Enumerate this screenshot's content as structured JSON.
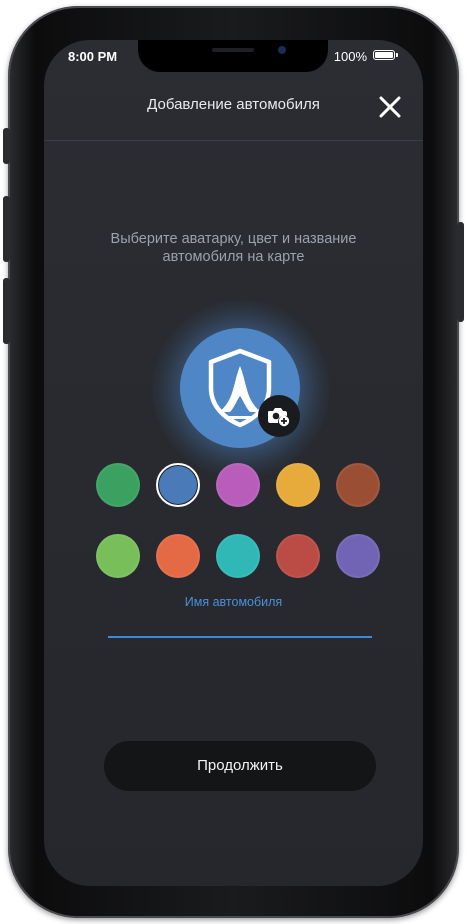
{
  "status_bar": {
    "time": "8:00 PM",
    "battery": "100%"
  },
  "header": {
    "title": "Добавление автомобиля",
    "close_icon": "close-icon"
  },
  "subtitle": "Выберите аватарку, цвет и название автомобиля на карте",
  "avatar": {
    "icon": "shield-car-icon",
    "color": "#4f86c6",
    "camera_icon": "camera-plus-icon"
  },
  "colors": [
    {
      "name": "green",
      "hex": "#3aa160",
      "selected": false
    },
    {
      "name": "blue",
      "hex": "#4a7ab8",
      "selected": true
    },
    {
      "name": "magenta",
      "hex": "#b85eba",
      "selected": false
    },
    {
      "name": "amber",
      "hex": "#e6ab3a",
      "selected": false
    },
    {
      "name": "brown",
      "hex": "#9a4f34",
      "selected": false
    },
    {
      "name": "light-green",
      "hex": "#78bf5a",
      "selected": false
    },
    {
      "name": "orange",
      "hex": "#e46a45",
      "selected": false
    },
    {
      "name": "teal",
      "hex": "#2fb8b5",
      "selected": false
    },
    {
      "name": "red",
      "hex": "#bb4b45",
      "selected": false
    },
    {
      "name": "violet",
      "hex": "#7264b4",
      "selected": false
    }
  ],
  "name_field": {
    "label": "Имя автомобиля",
    "value": ""
  },
  "continue_button": {
    "label": "Продолжить"
  }
}
